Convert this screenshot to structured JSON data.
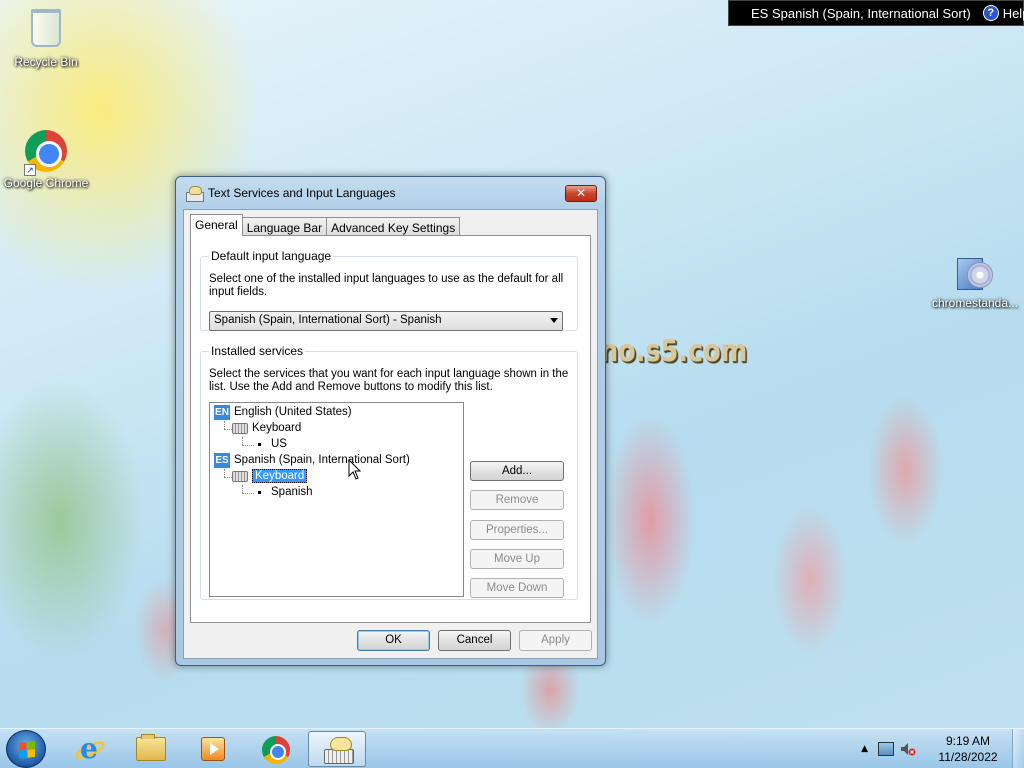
{
  "desktop": {
    "icons": [
      {
        "label": "Recycle Bin"
      },
      {
        "label": "Google Chrome"
      },
      {
        "label": "chromestanda..."
      }
    ],
    "watermark": "no.s5.com"
  },
  "language_bar": {
    "language": "ES Spanish (Spain, International Sort)",
    "help_label": "Help",
    "help_icon": "?"
  },
  "dialog": {
    "title": "Text Services and Input Languages",
    "close_glyph": "✕",
    "tabs": [
      "General",
      "Language Bar",
      "Advanced Key Settings"
    ],
    "active_tab": "General",
    "default_input": {
      "legend": "Default input language",
      "description": "Select one of the installed input languages to use as the default for all input fields.",
      "selected_value": "Spanish (Spain, International Sort) - Spanish"
    },
    "installed_services": {
      "legend": "Installed services",
      "description": "Select the services that you want for each input language shown in the list. Use the Add and Remove buttons to modify this list.",
      "tree": {
        "en_badge": "EN",
        "en_language": "English (United States)",
        "en_keyboard_label": "Keyboard",
        "en_layout": "US",
        "es_badge": "ES",
        "es_language": "Spanish (Spain, International Sort)",
        "es_keyboard_label": "Keyboard",
        "es_layout": "Spanish"
      },
      "selected_node": "Spanish (Spain, International Sort) / Keyboard",
      "buttons": {
        "add": "Add...",
        "remove": "Remove",
        "properties": "Properties...",
        "move_up": "Move Up",
        "move_down": "Move Down"
      }
    },
    "footer_buttons": {
      "ok": "OK",
      "cancel": "Cancel",
      "apply": "Apply"
    }
  },
  "taskbar": {
    "pinned": [
      "start-orb",
      "internet-explorer-icon",
      "windows-explorer-icon",
      "windows-media-player-icon",
      "google-chrome-icon",
      "text-services-icon"
    ],
    "active_app": "text-services-icon",
    "tray": {
      "show_hidden_glyph": "▲",
      "time": "9:19 AM",
      "date": "11/28/2022"
    }
  },
  "colors": {
    "selection": "#3399ff",
    "lang_badge": "#3a88d8",
    "langbar_bg": "#000000"
  }
}
